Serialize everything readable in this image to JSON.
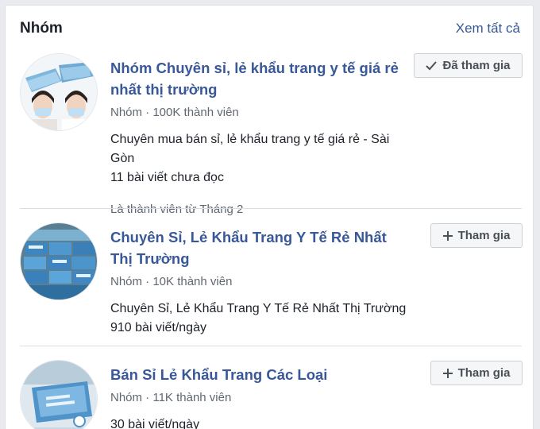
{
  "header": {
    "title": "Nhóm",
    "see_all": "Xem tất cả"
  },
  "groups": [
    {
      "name": "Nhóm Chuyên sỉ, lẻ khẩu trang y tế giá rẻ nhất thị trường",
      "meta": "Nhóm · 100K thành viên",
      "description": "Chuyên mua bán sỉ, lẻ khẩu trang y tế giá rẻ - Sài Gòn",
      "activity": "11 bài viết chưa đọc",
      "member_since": "Là thành viên từ Tháng 2",
      "button_label": "Đã tham gia",
      "button_icon": "check-icon"
    },
    {
      "name": "Chuyên Sỉ, Lẻ Khẩu Trang Y Tế Rẻ Nhất Thị Trường",
      "meta": "Nhóm · 10K thành viên",
      "description": "Chuyên Sỉ, Lẻ Khẩu Trang Y Tế Rẻ Nhất Thị Trường",
      "activity": "910 bài viết/ngày",
      "button_label": "Tham gia",
      "button_icon": "plus-icon"
    },
    {
      "name": "Bán Sỉ Lẻ Khẩu Trang Các Loại",
      "meta": "Nhóm · 11K thành viên",
      "activity": "30 bài viết/ngày",
      "button_label": "Tham gia",
      "button_icon": "plus-icon"
    }
  ],
  "colors": {
    "link": "#385898",
    "secondary_text": "#616770",
    "button_bg": "#f5f6f7",
    "divider": "#dadde1"
  }
}
